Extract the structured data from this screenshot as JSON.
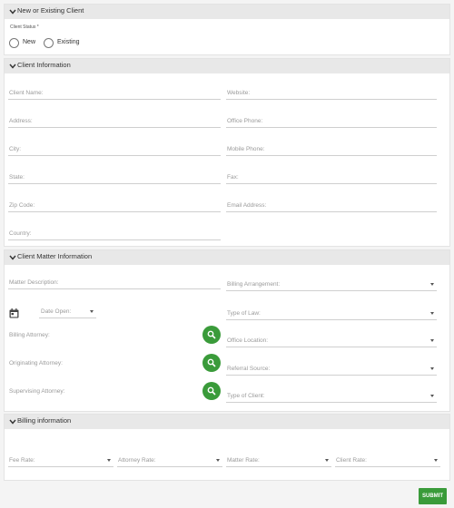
{
  "sections": {
    "client_type": {
      "title": "New or Existing Client",
      "status_label": "Client Status *",
      "options": [
        "New",
        "Existing"
      ]
    },
    "client_info": {
      "title": "Client Information",
      "fields": {
        "client_name": "Client Name:",
        "website": "Website:",
        "address": "Address:",
        "office_phone": "Office Phone:",
        "city": "City:",
        "mobile_phone": "Mobile Phone:",
        "state": "State:",
        "fax": "Fax:",
        "zip_code": "Zip Code:",
        "email": "Email Address:",
        "country": "Country:"
      }
    },
    "matter_info": {
      "title": "Client Matter Information",
      "fields": {
        "matter_description": "Matter Description:",
        "billing_arrangement": "Billing Arrangement:",
        "date_open": "Date Open:",
        "type_of_law": "Type of Law:",
        "billing_attorney": "Billing Attorney:",
        "office_location": "Office Location:",
        "originating_attorney": "Originating Attorney:",
        "referral_source": "Referral Source:",
        "supervising_attorney": "Supervising Attorney:",
        "type_of_client": "Type of Client:"
      }
    },
    "billing_info": {
      "title": "Billing information",
      "fields": {
        "fee_rate": "Fee Rate:",
        "attorney_rate": "Attorney Rate:",
        "matter_rate": "Matter Rate:",
        "client_rate": "Client Rate:"
      }
    }
  },
  "submit_label": "SUBMIT",
  "colors": {
    "accent": "#3a9b3a",
    "header_bg": "#e8e8e8"
  },
  "icons": [
    "chevron-down-icon",
    "calendar-icon",
    "search-icon"
  ]
}
